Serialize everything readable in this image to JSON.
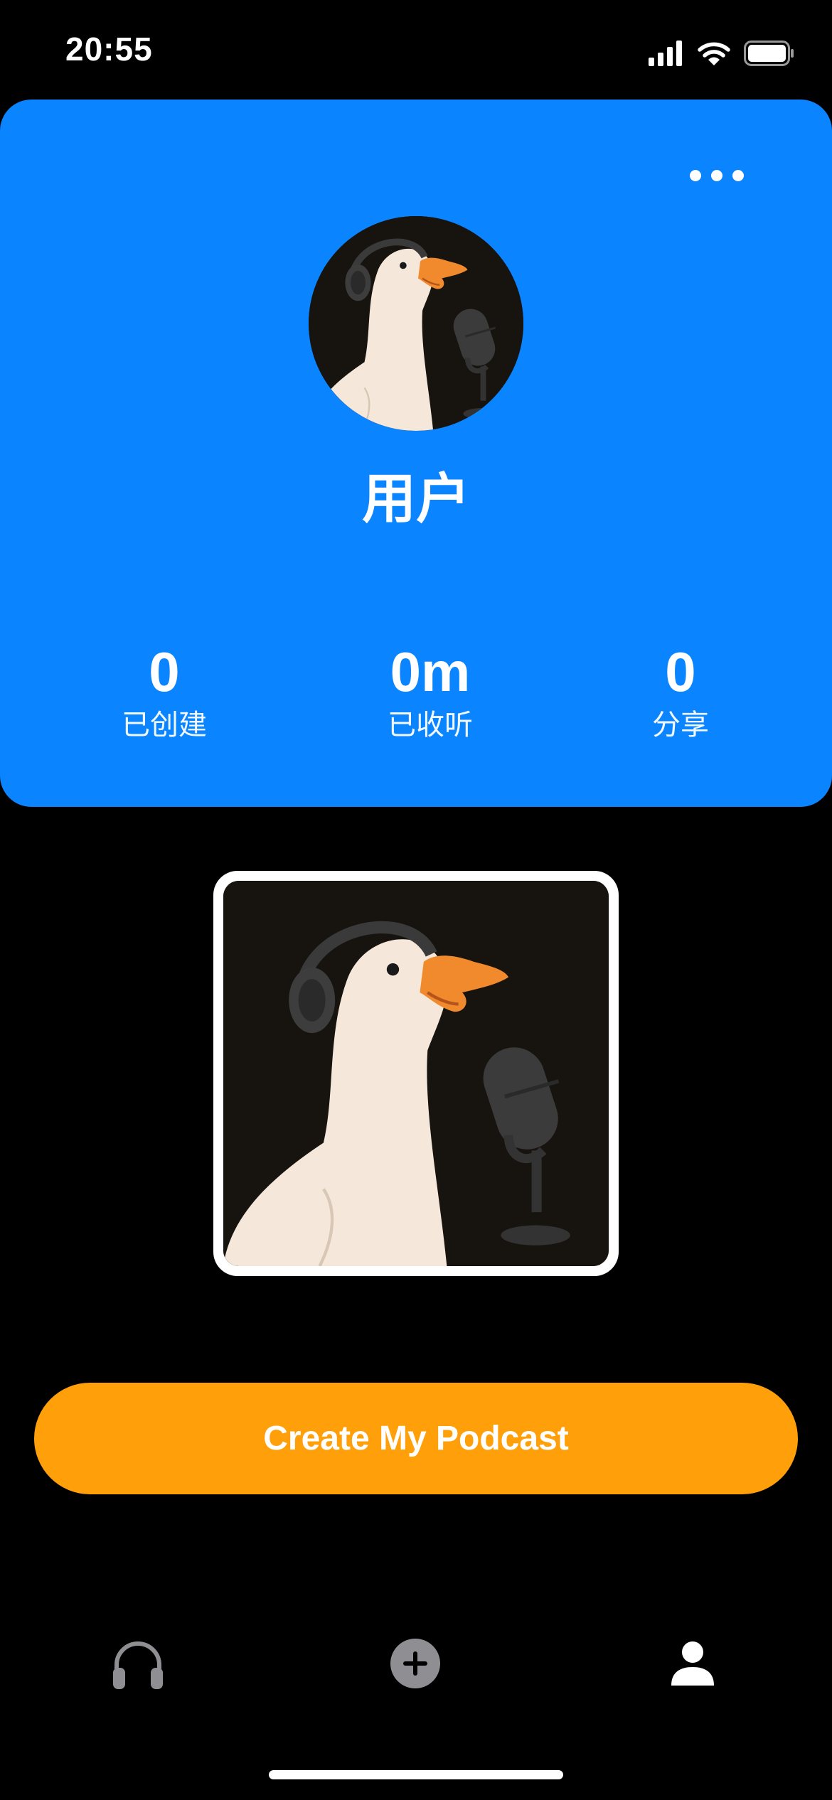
{
  "status_bar": {
    "time": "20:55",
    "icons": [
      "signal-icon",
      "wifi-icon",
      "battery-icon"
    ]
  },
  "profile": {
    "more_icon": "ellipsis-icon",
    "username": "用户",
    "stats": [
      {
        "value": "0",
        "label": "已创建"
      },
      {
        "value": "0m",
        "label": "已收听"
      },
      {
        "value": "0",
        "label": "分享"
      }
    ]
  },
  "create_button": {
    "label": "Create My Podcast"
  },
  "tab_bar": {
    "tabs": [
      {
        "icon": "headphones-icon",
        "active": false
      },
      {
        "icon": "plus-circle-icon",
        "active": false
      },
      {
        "icon": "person-icon",
        "active": true
      }
    ]
  },
  "colors": {
    "background": "#000000",
    "card_blue": "#0a84ff",
    "accent_orange": "#ff9f0a",
    "inactive_tab": "#8e8e93",
    "active_tab": "#ffffff"
  }
}
